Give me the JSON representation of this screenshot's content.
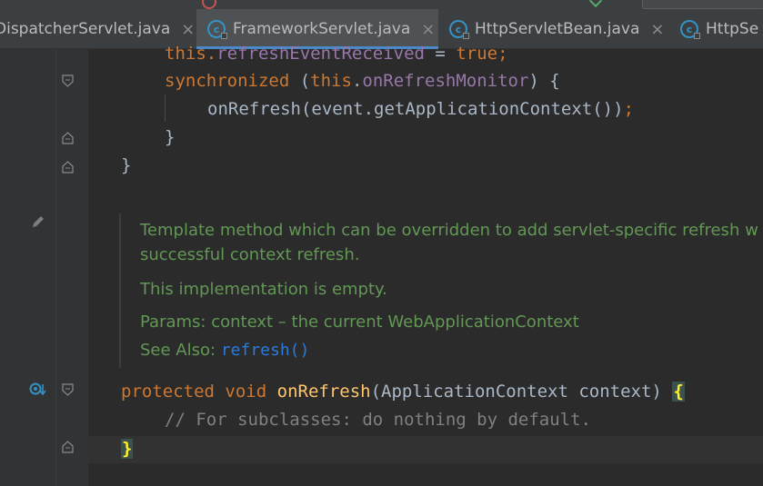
{
  "tabs": [
    {
      "label": "DispatcherServlet.java",
      "active": false,
      "icon": "class-icon"
    },
    {
      "label": "FrameworkServlet.java",
      "active": true,
      "icon": "class-icon"
    },
    {
      "label": "HttpServletBean.java",
      "active": false,
      "icon": "class-icon"
    },
    {
      "label": "HttpSe",
      "active": false,
      "icon": "class-icon"
    }
  ],
  "tab_close_glyph": "×",
  "class_icon_letter": "c",
  "code": {
    "line1": {
      "a": "this.",
      "b": "refreshEventReceived",
      "c": " = ",
      "d": "true;"
    },
    "line2": {
      "kw": "synchronized",
      "a": " (",
      "b": "this",
      "c": ".",
      "d": "onRefreshMonitor",
      "e": ") {"
    },
    "line3": {
      "a": "onRefresh(event.getApplicationContext())",
      "b": ";"
    },
    "line4": "}",
    "line5": "}",
    "sig": {
      "kw1": "protected",
      "kw2": "void",
      "fn": "onRefresh",
      "params": "(ApplicationContext context) ",
      "brace": "{"
    },
    "comment": "// For subclasses: do nothing by default.",
    "close": "}"
  },
  "doc": {
    "line1": "Template method which can be overridden to add servlet-specific refresh w",
    "line2": "successful context refresh.",
    "line3": "This implementation is empty.",
    "params_label": "Params:",
    "params_value": "context – the current WebApplicationContext",
    "see_label": "See Also:",
    "see_link": "refresh()"
  },
  "colors": {
    "keyword": "#cc7832",
    "function": "#ffc66d",
    "field": "#9876aa",
    "string": "#6a8759",
    "doc": "#629755",
    "link": "#287bde",
    "accent": "#4a88c7"
  }
}
